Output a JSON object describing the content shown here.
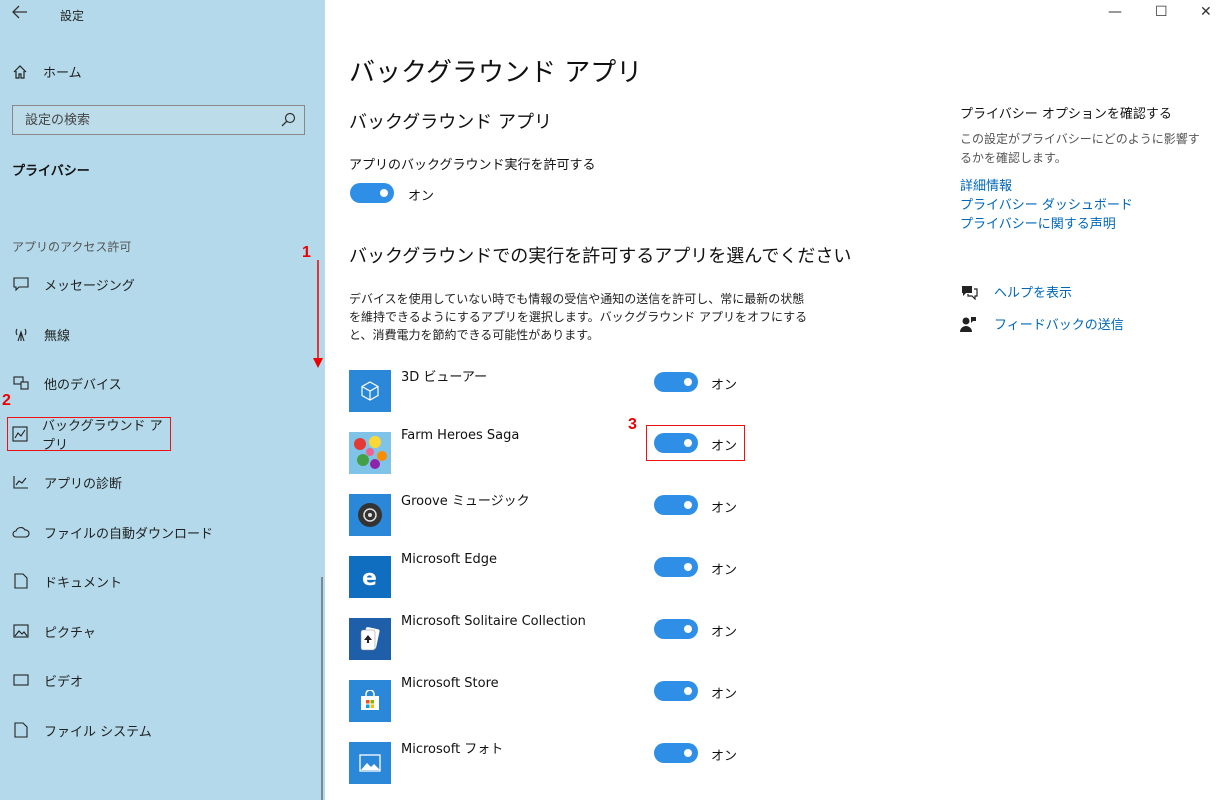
{
  "window": {
    "title": "設定",
    "back_icon": "back-arrow-icon",
    "controls": [
      "—",
      "☐",
      "✕"
    ]
  },
  "sidebar": {
    "home_label": "ホーム",
    "search_placeholder": "設定の検索",
    "section_title": "プライバシー",
    "group_label": "アプリのアクセス許可",
    "items": [
      {
        "label": "メッセージング",
        "icon": "message-icon"
      },
      {
        "label": "無線",
        "icon": "radio-antenna-icon"
      },
      {
        "label": "他のデバイス",
        "icon": "devices-icon"
      },
      {
        "label": "バックグラウンド アプリ",
        "icon": "background-apps-icon",
        "selected": true
      },
      {
        "label": "アプリの診断",
        "icon": "diagnostics-icon"
      },
      {
        "label": "ファイルの自動ダウンロード",
        "icon": "cloud-icon"
      },
      {
        "label": "ドキュメント",
        "icon": "document-icon"
      },
      {
        "label": "ピクチャ",
        "icon": "picture-icon"
      },
      {
        "label": "ビデオ",
        "icon": "video-icon"
      },
      {
        "label": "ファイル システム",
        "icon": "file-system-icon"
      }
    ]
  },
  "annotations": {
    "one": "1",
    "two": "2",
    "three": "3"
  },
  "main": {
    "page_title": "バックグラウンド アプリ",
    "section_title": "バックグラウンド アプリ",
    "allow_label": "アプリのバックグラウンド実行を許可する",
    "allow_state": "オン",
    "choose_heading": "バックグラウンドでの実行を許可するアプリを選んでください",
    "description": "デバイスを使用していない時でも情報の受信や通知の送信を許可し、常に最新の状態を維持できるようにするアプリを選択します。バックグラウンド アプリをオフにすると、消費電力を節約できる可能性があります。",
    "apps": [
      {
        "name": "3D ビューアー",
        "state": "オン",
        "icon": "cube-icon"
      },
      {
        "name": "Farm Heroes Saga",
        "state": "オン",
        "icon": "farm-heroes-icon"
      },
      {
        "name": "Groove ミュージック",
        "state": "オン",
        "icon": "groove-music-icon"
      },
      {
        "name": "Microsoft Edge",
        "state": "オン",
        "icon": "edge-icon"
      },
      {
        "name": "Microsoft Solitaire Collection",
        "state": "オン",
        "icon": "solitaire-icon"
      },
      {
        "name": "Microsoft Store",
        "state": "オン",
        "icon": "store-icon"
      },
      {
        "name": "Microsoft フォト",
        "state": "オン",
        "icon": "photos-icon"
      }
    ]
  },
  "right_panel": {
    "title": "プライバシー オプションを確認する",
    "description": "この設定がプライバシーにどのように影響するかを確認します。",
    "links": [
      "詳細情報",
      "プライバシー ダッシュボード",
      "プライバシーに関する声明"
    ],
    "help": "ヘルプを表示",
    "feedback": "フィードバックの送信"
  },
  "colors": {
    "accent": "#2f8fe6",
    "sidebar_bg": "#b3d9ea",
    "annotation": "#e00000",
    "link": "#0067b8"
  }
}
